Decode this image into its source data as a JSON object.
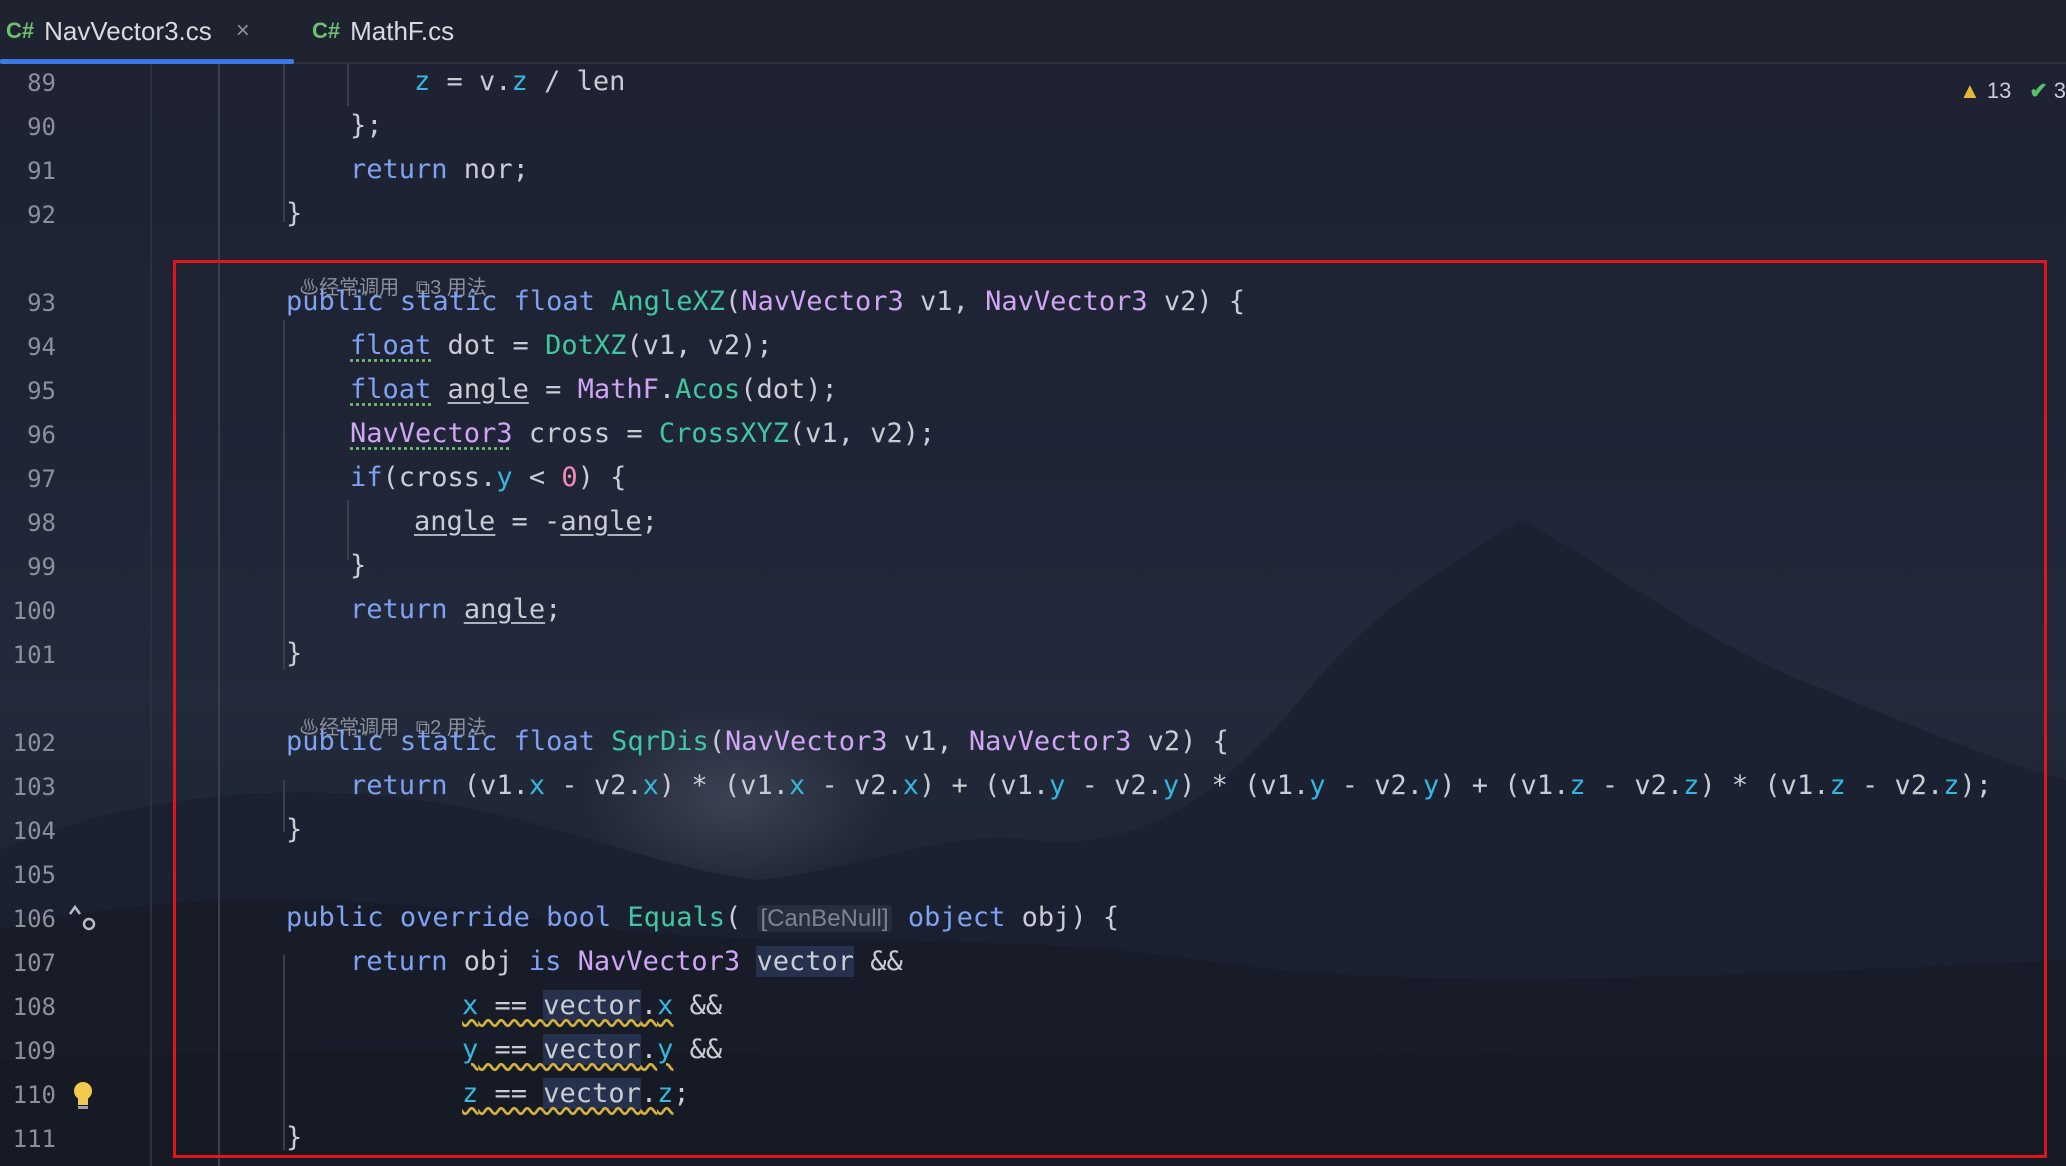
{
  "tabs": [
    {
      "lang": "C#",
      "name": "NavVector3.cs",
      "close": "×"
    },
    {
      "lang": "C#",
      "name": "MathF.cs"
    }
  ],
  "inspection": {
    "warnings": "13",
    "ok": "3"
  },
  "hints": {
    "frequent": "经常调用",
    "usages_93": "3 用法",
    "usages_102": "2 用法"
  },
  "line_numbers": [
    "89",
    "90",
    "91",
    "92",
    "93",
    "94",
    "95",
    "96",
    "97",
    "98",
    "99",
    "100",
    "101",
    "102",
    "103",
    "104",
    "105",
    "106",
    "107",
    "108",
    "109",
    "110",
    "111"
  ],
  "code": {
    "l89": [
      "z",
      " = v.",
      "z",
      " / len"
    ],
    "l90": "};",
    "l91": [
      "return",
      " nor;"
    ],
    "l92": "}",
    "l93": [
      "public",
      " ",
      "static",
      " ",
      "float",
      " ",
      "AngleXZ",
      "(",
      "NavVector3",
      " v1, ",
      "NavVector3",
      " v2) {"
    ],
    "l94": [
      "float",
      " dot = ",
      "DotXZ",
      "(v1, v2);"
    ],
    "l95": [
      "float",
      " ",
      "angle",
      " = ",
      "MathF",
      ".",
      "Acos",
      "(dot);"
    ],
    "l96": [
      "NavVector3",
      " cross = ",
      "CrossXYZ",
      "(v1, v2);"
    ],
    "l97": [
      "if",
      "(cross.",
      "y",
      " < ",
      "0",
      ") {"
    ],
    "l98": [
      "angle",
      " = -",
      "angle",
      ";"
    ],
    "l99": "}",
    "l100": [
      "return",
      " ",
      "angle",
      ";"
    ],
    "l101": "}",
    "l102": [
      "public",
      " ",
      "static",
      " ",
      "float",
      " ",
      "SqrDis",
      "(",
      "NavVector3",
      " v1, ",
      "NavVector3",
      " v2) {"
    ],
    "l103": [
      "return",
      " (v1.",
      "x",
      " - v2.",
      "x",
      ") * (v1.",
      "x",
      " - v2.",
      "x",
      ") + (v1.",
      "y",
      " - v2.",
      "y",
      ") * (v1.",
      "y",
      " - v2.",
      "y",
      ") + (v1.",
      "z",
      " - v2.",
      "z",
      ") * (v1.",
      "z",
      " - v2.",
      "z",
      ");"
    ],
    "l104": "}",
    "l106": [
      "public",
      " ",
      "override",
      " ",
      "bool",
      " ",
      "Equals",
      "( ",
      "[CanBeNull]",
      " ",
      "object",
      " obj) {"
    ],
    "l107": [
      "return",
      " obj ",
      "is",
      " ",
      "NavVector3",
      " ",
      "vector",
      " &&"
    ],
    "l108": [
      "x",
      " == ",
      "vector",
      ".",
      "x",
      " &&"
    ],
    "l109": [
      "y",
      " == ",
      "vector",
      ".",
      "y",
      " &&"
    ],
    "l110": [
      "z",
      " == ",
      "vector",
      ".",
      "z",
      ";"
    ],
    "l111": "}"
  },
  "colors": {
    "keyword": "#7ea1f2",
    "type": "#d0a5f5",
    "method": "#3fc8a0",
    "field": "#33b8e0",
    "number": "#f08db3",
    "highlight_box": "#e0141b",
    "accent": "#3d79e6"
  },
  "icons": [
    "warning-icon",
    "check-icon",
    "override-marker-icon",
    "lightbulb-icon",
    "flame-icon",
    "usages-icon"
  ]
}
